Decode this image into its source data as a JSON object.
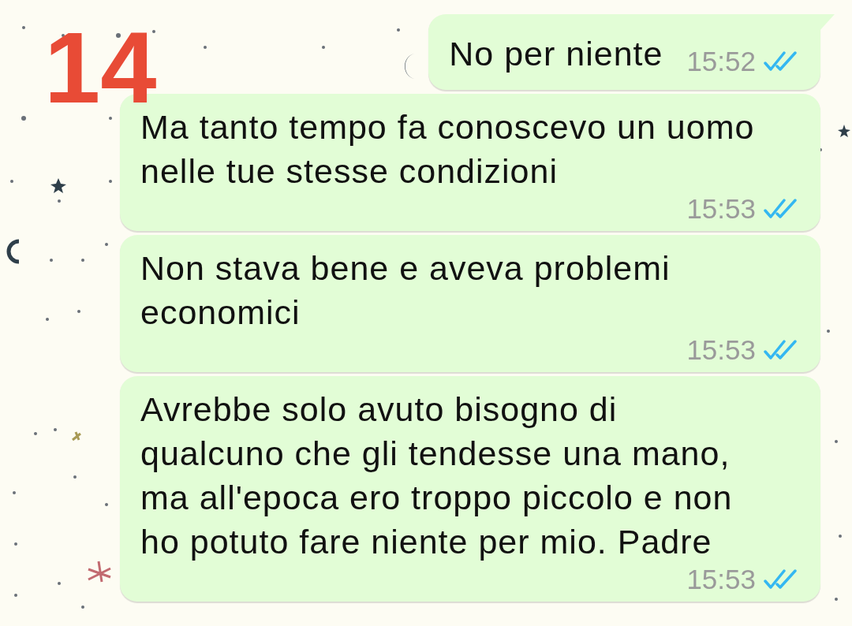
{
  "annotation": "14",
  "messages": [
    {
      "lines": [
        "No per niente"
      ],
      "time": "15:52",
      "read": true
    },
    {
      "lines": [
        "Ma tanto tempo fa conoscevo un uomo",
        "nelle tue stesse condizioni"
      ],
      "time": "15:53",
      "read": true
    },
    {
      "lines": [
        "Non stava bene e aveva problemi",
        "economici"
      ],
      "time": "15:53",
      "read": true
    },
    {
      "lines": [
        "Avrebbe solo avuto bisogno di",
        "qualcuno che gli tendesse una mano,",
        "ma all'epoca ero troppo piccolo e non",
        "ho potuto fare niente per mio. Padre"
      ],
      "time": "15:53",
      "read": true
    }
  ]
}
